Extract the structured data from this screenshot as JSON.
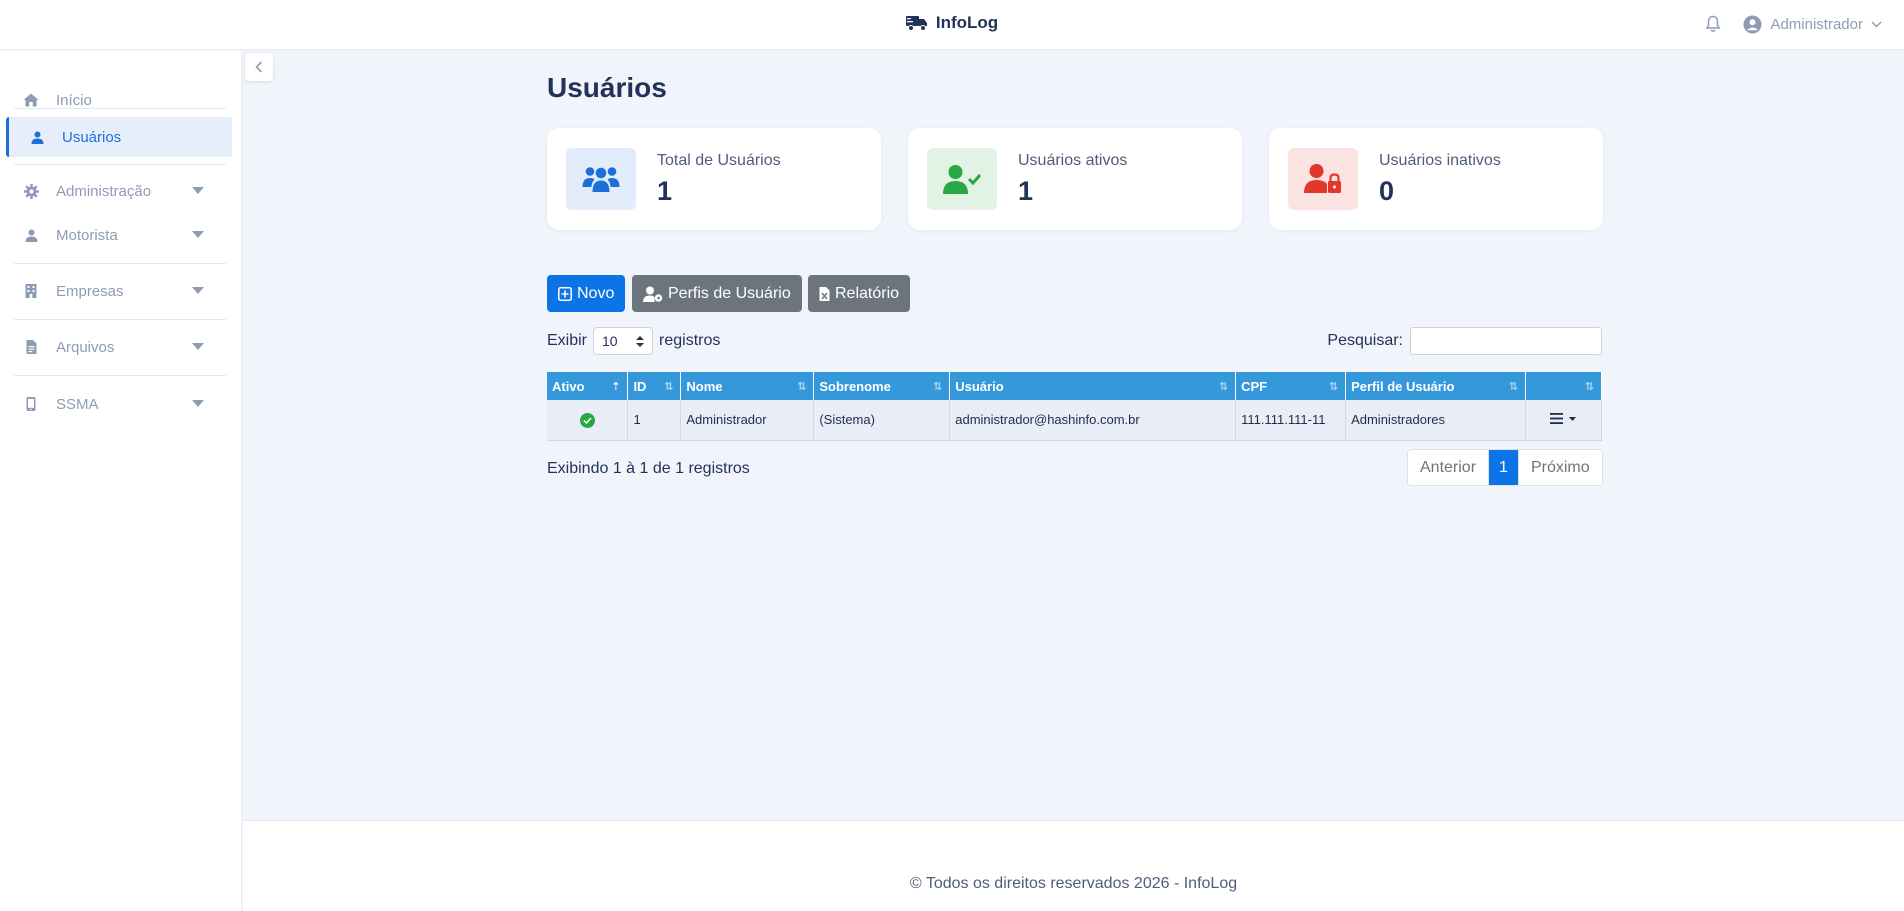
{
  "app": {
    "brand": "InfoLog",
    "user": "Administrador"
  },
  "sidebar": {
    "items": [
      {
        "label": "Início",
        "icon": "home-icon"
      },
      {
        "label": "Usuários",
        "icon": "user-icon",
        "active": true
      },
      {
        "label": "Administração",
        "icon": "gear-icon"
      },
      {
        "label": "Motorista",
        "icon": "user-icon"
      },
      {
        "label": "Empresas",
        "icon": "building-icon"
      },
      {
        "label": "Arquivos",
        "icon": "file-icon"
      },
      {
        "label": "SSMA",
        "icon": "tablet-icon"
      }
    ]
  },
  "page": {
    "title": "Usuários"
  },
  "cards": [
    {
      "label": "Total de Usuários",
      "value": "1",
      "color": "#1c6fd9",
      "bg": "#e3ecfa"
    },
    {
      "label": "Usuários ativos",
      "value": "1",
      "color": "#28a745",
      "bg": "#e2f3e6"
    },
    {
      "label": "Usuários inativos",
      "value": "0",
      "color": "#e2372c",
      "bg": "#fbe3e2"
    }
  ],
  "toolbar": {
    "new_label": "Novo",
    "profiles_label": "Perfis de Usuário",
    "report_label": "Relatório"
  },
  "table_controls": {
    "show_label": "Exibir",
    "page_size": "10",
    "records_label": "registros",
    "search_label": "Pesquisar:",
    "search_value": ""
  },
  "table": {
    "columns": [
      "Ativo",
      "ID",
      "Nome",
      "Sobrenome",
      "Usuário",
      "CPF",
      "Perfil de Usuário",
      ""
    ],
    "rows": [
      {
        "active": true,
        "id": "1",
        "nome": "Administrador",
        "sobrenome": "(Sistema)",
        "usuario": "administrador@hashinfo.com.br",
        "cpf": "111.111.111-11",
        "perfil": "Administradores"
      }
    ]
  },
  "pagination": {
    "info": "Exibindo 1 à 1 de 1 registros",
    "prev": "Anterior",
    "current": "1",
    "next": "Próximo"
  },
  "footer": {
    "text": "© Todos os direitos reservados 2026 - InfoLog"
  },
  "colors": {
    "primary": "#0d74e8",
    "table_header": "#3498db",
    "secondary_button": "#6c757d"
  }
}
